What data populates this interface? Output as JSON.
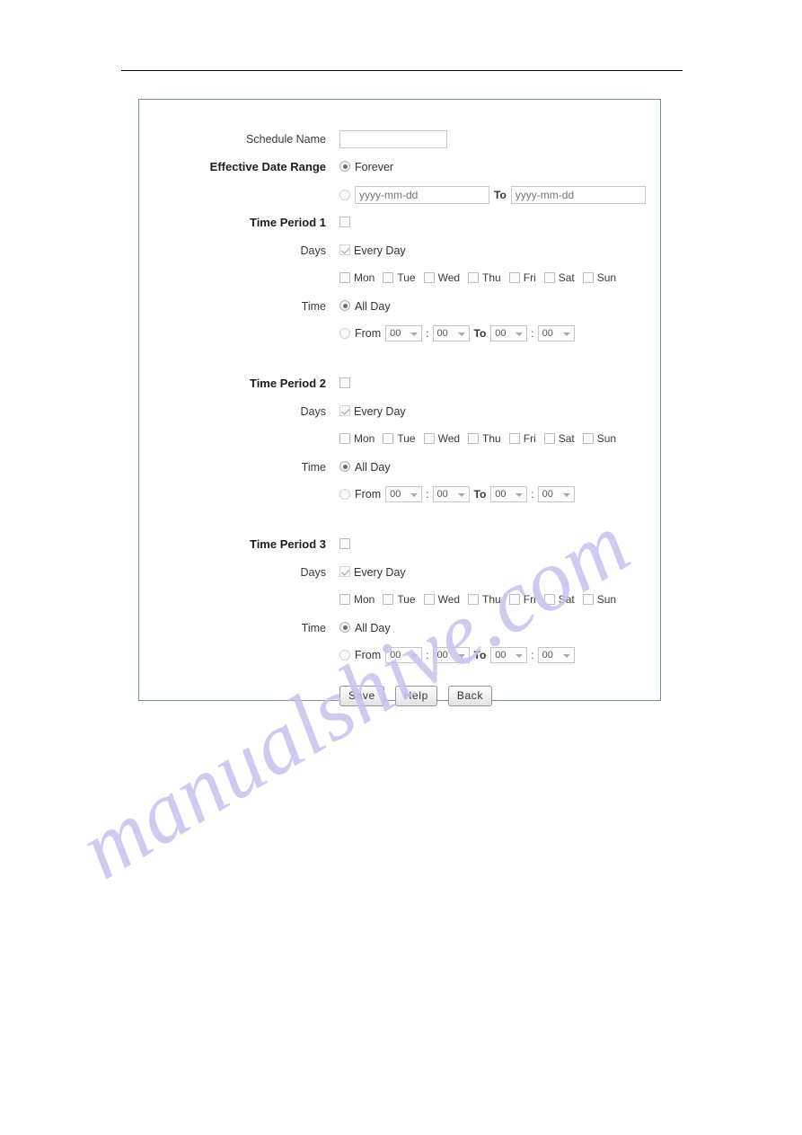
{
  "page": {
    "watermark": "manualshive.com"
  },
  "form": {
    "schedule_name": {
      "label": "Schedule Name",
      "value": "",
      "placeholder": ""
    },
    "effective_date_range": {
      "label": "Effective Date Range",
      "forever_label": "Forever",
      "forever_selected": true,
      "range_selected": false,
      "start_value": "",
      "start_placeholder": "yyyy-mm-dd",
      "to_label": "To",
      "end_value": "",
      "end_placeholder": "yyyy-mm-dd"
    },
    "days_label": "Days",
    "time_label": "Time",
    "every_day_label": "Every Day",
    "all_day_label": "All Day",
    "from_label": "From",
    "to_label": "To",
    "colon": ":",
    "weekdays": [
      {
        "label": "Mon",
        "checked": false
      },
      {
        "label": "Tue",
        "checked": false
      },
      {
        "label": "Wed",
        "checked": false
      },
      {
        "label": "Thu",
        "checked": false
      },
      {
        "label": "Fri",
        "checked": false
      },
      {
        "label": "Sat",
        "checked": false
      },
      {
        "label": "Sun",
        "checked": false
      }
    ],
    "time_value": "00",
    "periods": [
      {
        "label": "Time Period 1",
        "enabled": false,
        "every_day": true,
        "all_day": true,
        "from_hour": "00",
        "from_min": "00",
        "to_hour": "00",
        "to_min": "00"
      },
      {
        "label": "Time Period 2",
        "enabled": false,
        "every_day": true,
        "all_day": true,
        "from_hour": "00",
        "from_min": "00",
        "to_hour": "00",
        "to_min": "00"
      },
      {
        "label": "Time Period 3",
        "enabled": false,
        "every_day": true,
        "all_day": true,
        "from_hour": "00",
        "from_min": "00",
        "to_hour": "00",
        "to_min": "00"
      }
    ]
  },
  "buttons": {
    "save": "Save",
    "help": "Help",
    "back": "Back"
  },
  "colors": {
    "panel_border": "#6f9388",
    "watermark": "#c8c4ef",
    "rule": "#000000"
  }
}
